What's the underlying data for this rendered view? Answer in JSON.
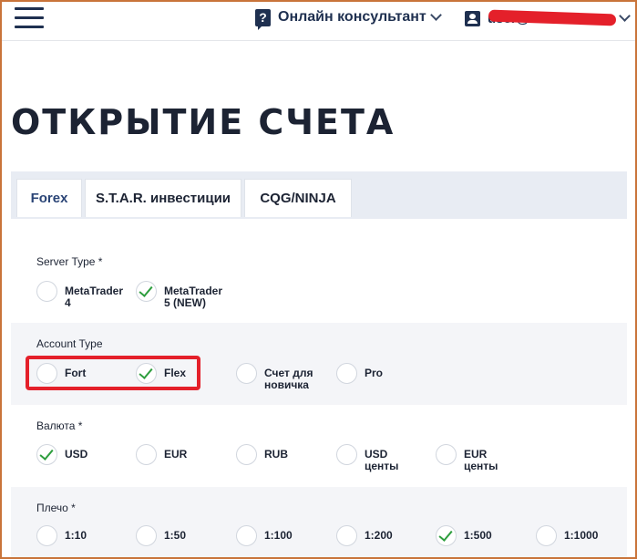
{
  "header": {
    "consultant_label": "Онлайн консультант",
    "user_email": "user@mail.ru"
  },
  "page_title": "ОТКРЫТИЕ СЧЕТА",
  "tabs": [
    {
      "label": "Forex",
      "active": true
    },
    {
      "label": "S.T.A.R. инвестиции",
      "active": false
    },
    {
      "label": "CQG/NINJA",
      "active": false
    }
  ],
  "server_type": {
    "label": "Server Type *",
    "options": [
      {
        "label": "MetaTrader 4",
        "checked": false
      },
      {
        "label": "MetaTrader 5 (NEW)",
        "checked": true
      }
    ]
  },
  "account_type": {
    "label": "Account Type",
    "options": [
      {
        "label": "Fort",
        "checked": false
      },
      {
        "label": "Flex",
        "checked": true
      },
      {
        "label": "Счет для новичка",
        "checked": false
      },
      {
        "label": "Pro",
        "checked": false
      }
    ]
  },
  "currency": {
    "label": "Валюта *",
    "options": [
      {
        "label": "USD",
        "checked": true
      },
      {
        "label": "EUR",
        "checked": false
      },
      {
        "label": "RUB",
        "checked": false
      },
      {
        "label": "USD центы",
        "checked": false
      },
      {
        "label": "EUR центы",
        "checked": false
      }
    ]
  },
  "leverage": {
    "label": "Плечо *",
    "options": [
      {
        "label": "1:10",
        "checked": false
      },
      {
        "label": "1:50",
        "checked": false
      },
      {
        "label": "1:100",
        "checked": false
      },
      {
        "label": "1:200",
        "checked": false
      },
      {
        "label": "1:500",
        "checked": true
      },
      {
        "label": "1:1000",
        "checked": false
      }
    ]
  },
  "colors": {
    "accent_navy": "#1f3050",
    "check_green": "#2e9e3e",
    "highlight_red": "#e4202a"
  }
}
